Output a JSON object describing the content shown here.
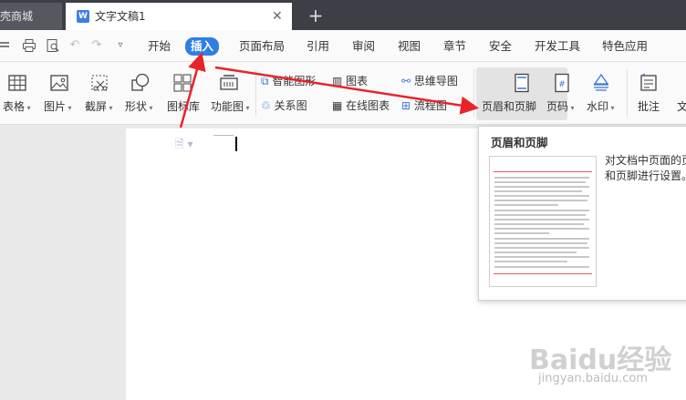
{
  "tabs": {
    "shop_label": "壳商城",
    "doc_label": "文字文稿1",
    "doc_icon": "W",
    "close": "✕",
    "add": "+"
  },
  "menu": {
    "items": [
      "开始",
      "插入",
      "页面布局",
      "引用",
      "审阅",
      "视图",
      "章节",
      "安全",
      "开发工具",
      "特色应用"
    ],
    "active": "插入"
  },
  "toolbar": {
    "table": "表格",
    "picture": "图片",
    "screenshot": "截屏",
    "shape": "形状",
    "icon_lib": "图标库",
    "function_chart": "功能图",
    "smart_shape": "智能图形",
    "chart": "图表",
    "mind_map": "思维导图",
    "relation": "关系图",
    "online_chart": "在线图表",
    "flowchart": "流程图",
    "header_footer": "页眉和页脚",
    "page_number": "页码",
    "watermark": "水印",
    "comment": "批注",
    "text_partial": "文"
  },
  "tooltip": {
    "title": "页眉和页脚",
    "description": "对文档中页面的页眉和页脚进行设置。"
  },
  "watermark": {
    "brand": "Baidu经验",
    "url": "jingyan.baidu.com"
  },
  "colors": {
    "accent": "#2f7fe3",
    "arrow": "#e8232a",
    "tabbar": "#3c3f45"
  }
}
